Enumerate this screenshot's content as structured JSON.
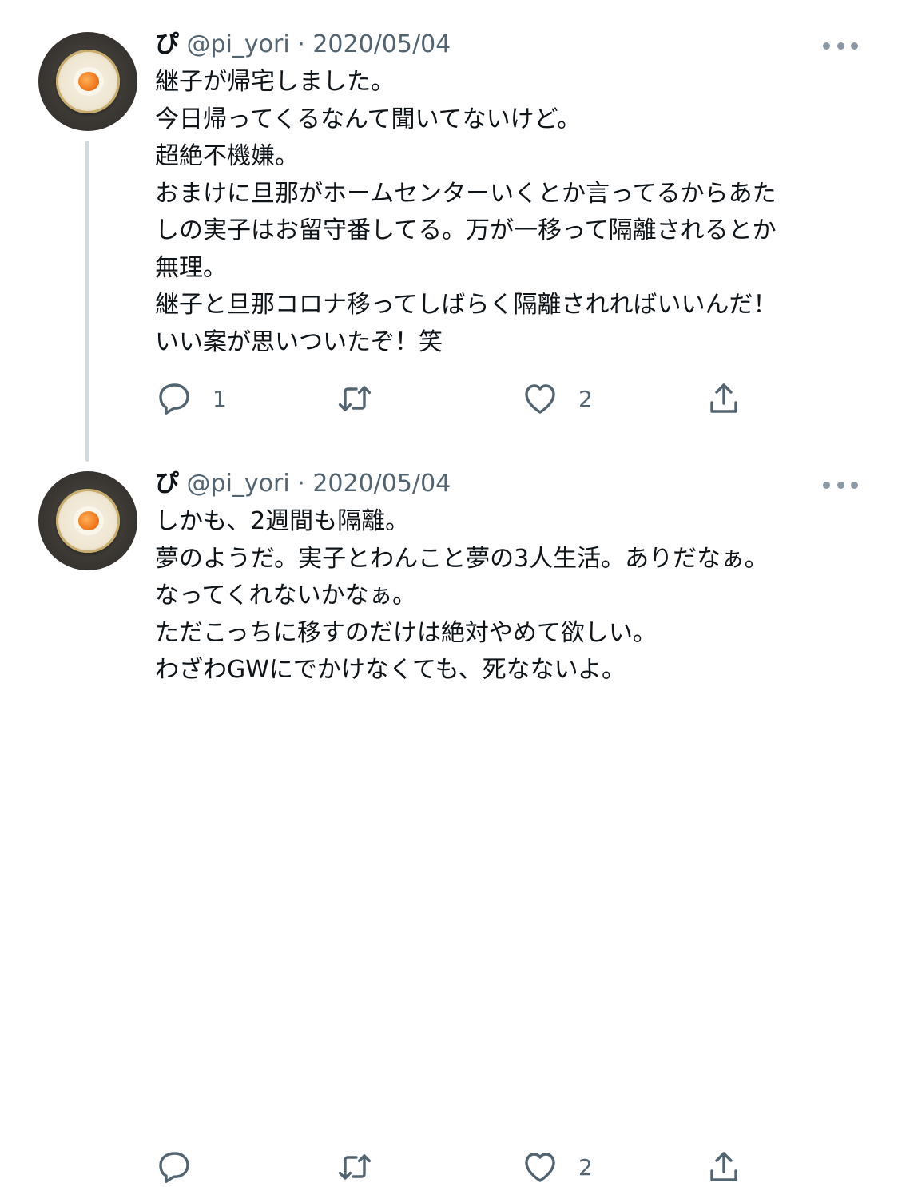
{
  "tweets": [
    {
      "author": {
        "name": "ぴ",
        "handle": "@pi_yori",
        "separator": "·"
      },
      "date": "2020/05/04",
      "lines": [
        "継子が帰宅しました。",
        "今日帰ってくるなんて聞いてないけど。",
        "超絶不機嫌。",
        "おまけに旦那がホームセンターいくとか言ってるからあた",
        "しの実子はお留守番してる。万が一移って隔離されるとか",
        "無理。",
        "継子と旦那コロナ移ってしばらく隔離されればいいんだ！",
        "いい案が思いついたぞ！笑"
      ],
      "reply_count": "1",
      "retweet_count": "",
      "like_count": "2",
      "icons": {
        "reply": "reply-icon",
        "retweet": "retweet-icon",
        "like": "heart-icon",
        "share": "share-icon",
        "more": "more-icon"
      }
    },
    {
      "author": {
        "name": "ぴ",
        "handle": "@pi_yori",
        "separator": "·"
      },
      "date": "2020/05/04",
      "lines": [
        "しかも、2週間も隔離。",
        "夢のようだ。実子とわんこと夢の3人生活。ありだなぁ。",
        "なってくれないかなぁ。",
        "ただこっちに移すのだけは絶対やめて欲しい。",
        "わざわGWにでかけなくても、死なないよ。"
      ],
      "reply_count": "",
      "retweet_count": "",
      "like_count": "2",
      "icons": {
        "reply": "reply-icon",
        "retweet": "retweet-icon",
        "like": "heart-icon",
        "share": "share-icon",
        "more": "more-icon"
      }
    }
  ],
  "colors": {
    "text": "#0f1419",
    "secondary": "#536471",
    "thread_line": "#cfd9de",
    "background": "#ffffff"
  }
}
